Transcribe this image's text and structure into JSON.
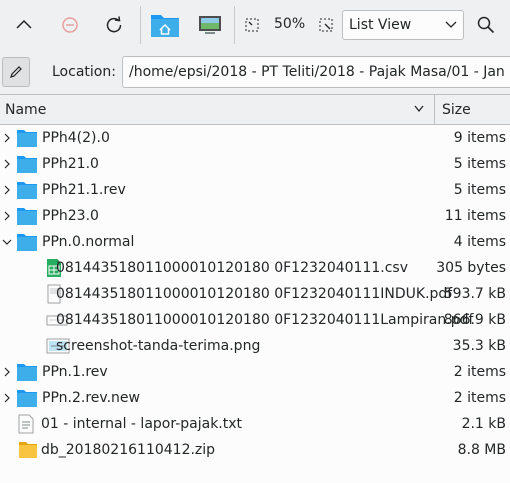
{
  "toolbar": {
    "zoom": "50%",
    "view_mode": "List View"
  },
  "location": {
    "label": "Location:",
    "path": "/home/epsi/2018 - PT Teliti/2018 - Pajak Masa/01 - Jan"
  },
  "columns": {
    "name": "Name",
    "size": "Size"
  },
  "colors": {
    "folder": "#3daee9",
    "folder_dark": "#1d99f3",
    "accent": "#3daee9",
    "archive": "#f9c440"
  },
  "files": [
    {
      "name": "PPh4(2).0",
      "size": "9 items",
      "kind": "folder",
      "depth": 0,
      "expander": "collapsed"
    },
    {
      "name": "PPh21.0",
      "size": "5 items",
      "kind": "folder",
      "depth": 0,
      "expander": "collapsed"
    },
    {
      "name": "PPh21.1.rev",
      "size": "5 items",
      "kind": "folder",
      "depth": 0,
      "expander": "collapsed"
    },
    {
      "name": "PPh23.0",
      "size": "11 items",
      "kind": "folder",
      "depth": 0,
      "expander": "collapsed"
    },
    {
      "name": "PPn.0.normal",
      "size": "4 items",
      "kind": "folder",
      "depth": 0,
      "expander": "expanded"
    },
    {
      "name": "081443518011000010120180 0F1232040111.csv",
      "size": "305 bytes",
      "kind": "csv",
      "depth": 1,
      "expander": "none"
    },
    {
      "name": "081443518011000010120180 0F1232040111INDUK.pdf",
      "size": "593.7 kB",
      "kind": "pdf",
      "depth": 1,
      "expander": "none"
    },
    {
      "name": "081443518011000010120180 0F1232040111Lampiran.pdf",
      "size": "866.9 kB",
      "kind": "pdf-wide",
      "depth": 1,
      "expander": "none"
    },
    {
      "name": "screenshot-tanda-terima.png",
      "size": "35.3 kB",
      "kind": "image",
      "depth": 1,
      "expander": "none"
    },
    {
      "name": "PPn.1.rev",
      "size": "2 items",
      "kind": "folder",
      "depth": 0,
      "expander": "collapsed"
    },
    {
      "name": "PPn.2.rev.new",
      "size": "2 items",
      "kind": "folder",
      "depth": 0,
      "expander": "collapsed"
    },
    {
      "name": "01 - internal - lapor-pajak.txt",
      "size": "2.1 kB",
      "kind": "text",
      "depth": 0,
      "expander": "none"
    },
    {
      "name": "db_20180216110412.zip",
      "size": "8.8 MB",
      "kind": "zip",
      "depth": 0,
      "expander": "none"
    }
  ]
}
